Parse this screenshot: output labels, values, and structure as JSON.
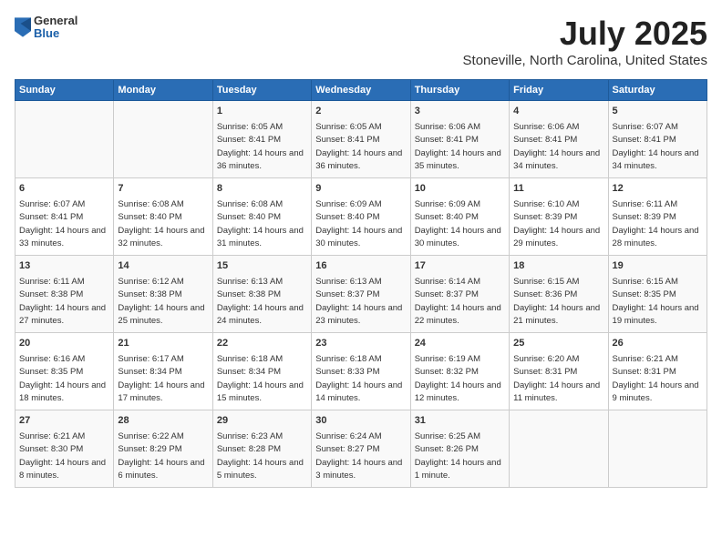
{
  "logo": {
    "general": "General",
    "blue": "Blue"
  },
  "title": "July 2025",
  "subtitle": "Stoneville, North Carolina, United States",
  "days_of_week": [
    "Sunday",
    "Monday",
    "Tuesday",
    "Wednesday",
    "Thursday",
    "Friday",
    "Saturday"
  ],
  "weeks": [
    [
      {
        "day": "",
        "info": ""
      },
      {
        "day": "",
        "info": ""
      },
      {
        "day": "1",
        "info": "Sunrise: 6:05 AM\nSunset: 8:41 PM\nDaylight: 14 hours and 36 minutes."
      },
      {
        "day": "2",
        "info": "Sunrise: 6:05 AM\nSunset: 8:41 PM\nDaylight: 14 hours and 36 minutes."
      },
      {
        "day": "3",
        "info": "Sunrise: 6:06 AM\nSunset: 8:41 PM\nDaylight: 14 hours and 35 minutes."
      },
      {
        "day": "4",
        "info": "Sunrise: 6:06 AM\nSunset: 8:41 PM\nDaylight: 14 hours and 34 minutes."
      },
      {
        "day": "5",
        "info": "Sunrise: 6:07 AM\nSunset: 8:41 PM\nDaylight: 14 hours and 34 minutes."
      }
    ],
    [
      {
        "day": "6",
        "info": "Sunrise: 6:07 AM\nSunset: 8:41 PM\nDaylight: 14 hours and 33 minutes."
      },
      {
        "day": "7",
        "info": "Sunrise: 6:08 AM\nSunset: 8:40 PM\nDaylight: 14 hours and 32 minutes."
      },
      {
        "day": "8",
        "info": "Sunrise: 6:08 AM\nSunset: 8:40 PM\nDaylight: 14 hours and 31 minutes."
      },
      {
        "day": "9",
        "info": "Sunrise: 6:09 AM\nSunset: 8:40 PM\nDaylight: 14 hours and 30 minutes."
      },
      {
        "day": "10",
        "info": "Sunrise: 6:09 AM\nSunset: 8:40 PM\nDaylight: 14 hours and 30 minutes."
      },
      {
        "day": "11",
        "info": "Sunrise: 6:10 AM\nSunset: 8:39 PM\nDaylight: 14 hours and 29 minutes."
      },
      {
        "day": "12",
        "info": "Sunrise: 6:11 AM\nSunset: 8:39 PM\nDaylight: 14 hours and 28 minutes."
      }
    ],
    [
      {
        "day": "13",
        "info": "Sunrise: 6:11 AM\nSunset: 8:38 PM\nDaylight: 14 hours and 27 minutes."
      },
      {
        "day": "14",
        "info": "Sunrise: 6:12 AM\nSunset: 8:38 PM\nDaylight: 14 hours and 25 minutes."
      },
      {
        "day": "15",
        "info": "Sunrise: 6:13 AM\nSunset: 8:38 PM\nDaylight: 14 hours and 24 minutes."
      },
      {
        "day": "16",
        "info": "Sunrise: 6:13 AM\nSunset: 8:37 PM\nDaylight: 14 hours and 23 minutes."
      },
      {
        "day": "17",
        "info": "Sunrise: 6:14 AM\nSunset: 8:37 PM\nDaylight: 14 hours and 22 minutes."
      },
      {
        "day": "18",
        "info": "Sunrise: 6:15 AM\nSunset: 8:36 PM\nDaylight: 14 hours and 21 minutes."
      },
      {
        "day": "19",
        "info": "Sunrise: 6:15 AM\nSunset: 8:35 PM\nDaylight: 14 hours and 19 minutes."
      }
    ],
    [
      {
        "day": "20",
        "info": "Sunrise: 6:16 AM\nSunset: 8:35 PM\nDaylight: 14 hours and 18 minutes."
      },
      {
        "day": "21",
        "info": "Sunrise: 6:17 AM\nSunset: 8:34 PM\nDaylight: 14 hours and 17 minutes."
      },
      {
        "day": "22",
        "info": "Sunrise: 6:18 AM\nSunset: 8:34 PM\nDaylight: 14 hours and 15 minutes."
      },
      {
        "day": "23",
        "info": "Sunrise: 6:18 AM\nSunset: 8:33 PM\nDaylight: 14 hours and 14 minutes."
      },
      {
        "day": "24",
        "info": "Sunrise: 6:19 AM\nSunset: 8:32 PM\nDaylight: 14 hours and 12 minutes."
      },
      {
        "day": "25",
        "info": "Sunrise: 6:20 AM\nSunset: 8:31 PM\nDaylight: 14 hours and 11 minutes."
      },
      {
        "day": "26",
        "info": "Sunrise: 6:21 AM\nSunset: 8:31 PM\nDaylight: 14 hours and 9 minutes."
      }
    ],
    [
      {
        "day": "27",
        "info": "Sunrise: 6:21 AM\nSunset: 8:30 PM\nDaylight: 14 hours and 8 minutes."
      },
      {
        "day": "28",
        "info": "Sunrise: 6:22 AM\nSunset: 8:29 PM\nDaylight: 14 hours and 6 minutes."
      },
      {
        "day": "29",
        "info": "Sunrise: 6:23 AM\nSunset: 8:28 PM\nDaylight: 14 hours and 5 minutes."
      },
      {
        "day": "30",
        "info": "Sunrise: 6:24 AM\nSunset: 8:27 PM\nDaylight: 14 hours and 3 minutes."
      },
      {
        "day": "31",
        "info": "Sunrise: 6:25 AM\nSunset: 8:26 PM\nDaylight: 14 hours and 1 minute."
      },
      {
        "day": "",
        "info": ""
      },
      {
        "day": "",
        "info": ""
      }
    ]
  ]
}
